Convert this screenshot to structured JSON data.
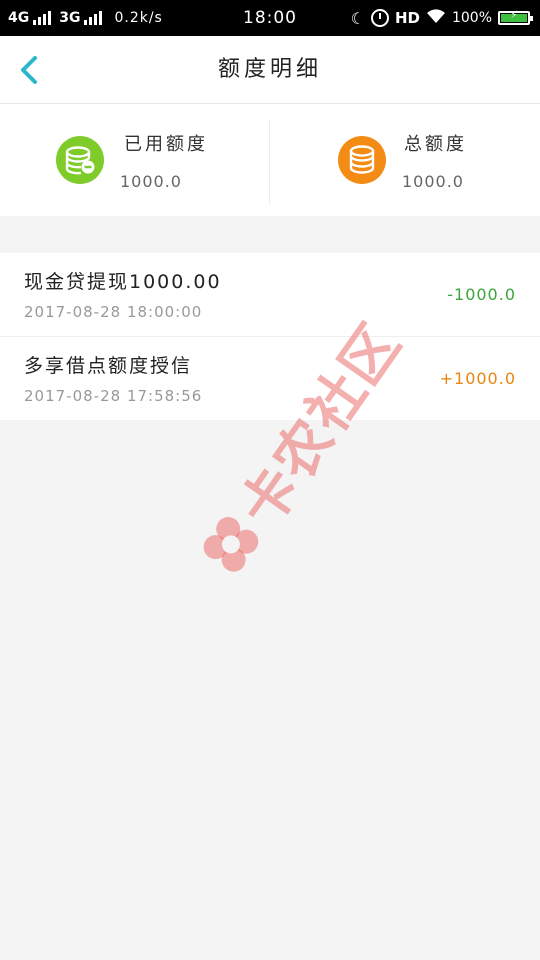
{
  "status_bar": {
    "network1": "4G",
    "network2": "3G",
    "speed": "0.2k/s",
    "time": "18:00",
    "hd": "HD",
    "battery": "100%"
  },
  "nav": {
    "title": "额度明细"
  },
  "summary": {
    "used": {
      "label": "已用额度",
      "value": "1000.0",
      "color": "#7ecb2a"
    },
    "total": {
      "label": "总额度",
      "value": "1000.0",
      "color": "#f38b14"
    }
  },
  "records": [
    {
      "title": "现金贷提现1000.00",
      "time": "2017-08-28 18:00:00",
      "amount": "-1000.0",
      "color": "#3aa53a"
    },
    {
      "title": "多享借点额度授信",
      "time": "2017-08-28 17:58:56",
      "amount": "+1000.0",
      "color": "#e8860f"
    }
  ],
  "watermark": {
    "text": "卡农社区"
  }
}
